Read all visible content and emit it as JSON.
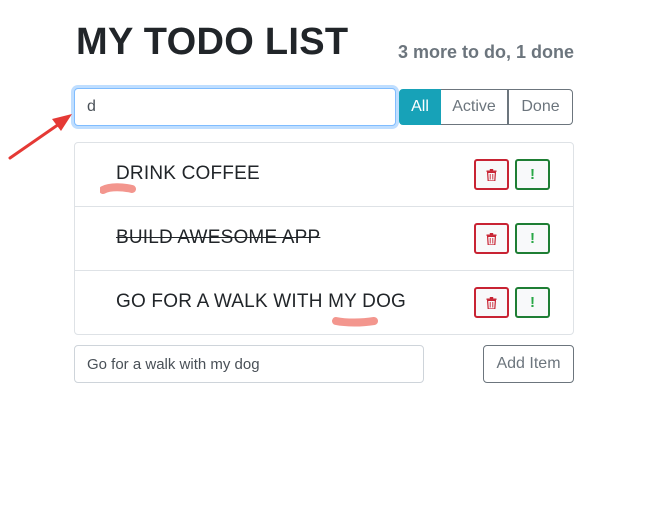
{
  "header": {
    "title": "MY TODO LIST",
    "stats": "3 more to do, 1 done"
  },
  "filter": {
    "search_value": "d",
    "buttons": [
      "All",
      "Active",
      "Done"
    ],
    "selected": "All"
  },
  "items": [
    {
      "label": "DRINK COFFEE",
      "done": false
    },
    {
      "label": "BUILD AWESOME APP",
      "done": true
    },
    {
      "label": "GO FOR A WALK WITH MY DOG",
      "done": false
    }
  ],
  "item_buttons": {
    "delete_icon": "trash-icon",
    "important_label": "!"
  },
  "add": {
    "input_value": "Go for a walk with my dog",
    "button_label": "Add Item"
  },
  "colors": {
    "accent": "#17a2b8",
    "danger": "#c82333",
    "success": "#28a745",
    "muted": "#6c757d",
    "annotation_red": "#e53935",
    "highlight": "#f28b82"
  },
  "annotation_icons": [
    "red-arrow-icon",
    "highlight-mark-icon"
  ]
}
